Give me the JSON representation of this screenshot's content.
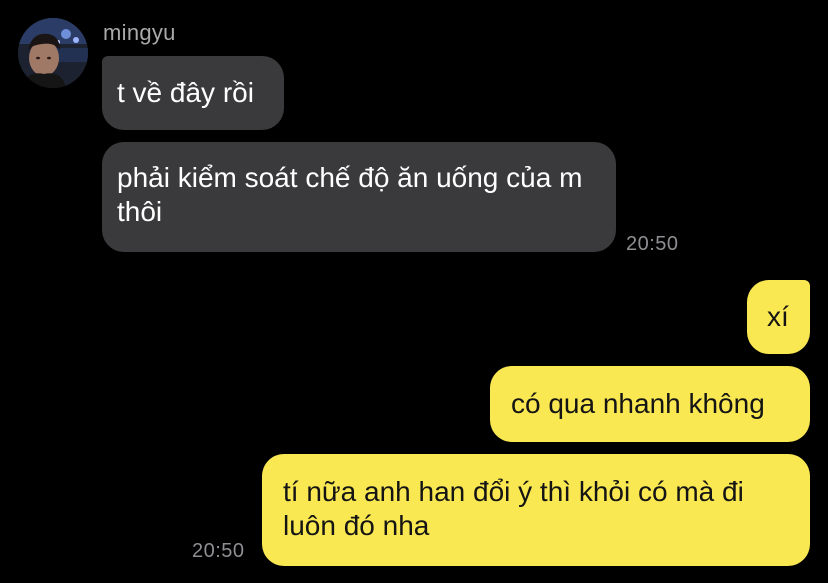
{
  "contact": {
    "name": "mingyu",
    "avatar_icon": "profile-photo"
  },
  "colors": {
    "background": "#000000",
    "incoming_bubble": "#3a3a3c",
    "outgoing_bubble": "#fae852",
    "timestamp": "#8e8e93"
  },
  "messages": [
    {
      "from": "mingyu",
      "direction": "incoming",
      "text": "t về đây rồi"
    },
    {
      "from": "mingyu",
      "direction": "incoming",
      "text": "phải kiểm soát chế độ ăn uống của m thôi",
      "time": "20:50"
    },
    {
      "from": "me",
      "direction": "outgoing",
      "text": "xí"
    },
    {
      "from": "me",
      "direction": "outgoing",
      "text": "có qua nhanh không"
    },
    {
      "from": "me",
      "direction": "outgoing",
      "text": "tí nữa anh han đổi ý thì khỏi có mà đi luôn đó nha",
      "time": "20:50"
    }
  ]
}
